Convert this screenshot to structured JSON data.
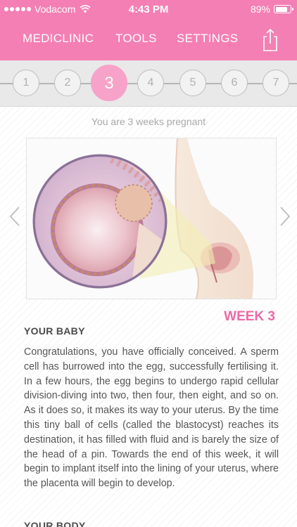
{
  "status_bar": {
    "carrier": "Vodacom",
    "time": "4:43 PM",
    "battery": "89%",
    "battery_level": 0.89
  },
  "nav": {
    "items": [
      "MEDICLINIC",
      "TOOLS",
      "SETTINGS"
    ],
    "share_icon": "share-icon"
  },
  "weeks": {
    "items": [
      "1",
      "2",
      "3",
      "4",
      "5",
      "6",
      "7"
    ],
    "selected": "3"
  },
  "colors": {
    "brand_pink": "#f47fb4",
    "accent_pink": "#ec6aa6",
    "active_week": "#f7a2c9"
  },
  "content": {
    "pregnant_status": "You are 3 weeks pregnant",
    "week_title": "WEEK 3",
    "baby_heading": "YOUR BABY",
    "baby_text": "Congratulations, you have officially conceived. A sperm cell has burrowed into the egg, successfully fertilising it. In a few hours, the egg begins to undergo rapid cellular division-diving into two, then four, then eight, and so on. As it does so, it makes its way to your uterus. By the time this tiny ball of cells (called the blastocyst) reaches its destination, it has filled with fluid and is barely the size of the head of a pin. Towards the end of this week, it will begin to implant itself into the lining of your uterus, where the placenta will begin to develop.",
    "body_heading": "YOUR BODY"
  }
}
